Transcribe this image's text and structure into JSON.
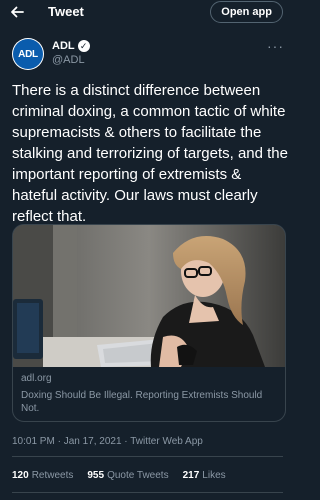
{
  "topbar": {
    "title": "Tweet",
    "open_app_label": "Open app"
  },
  "author": {
    "name": "ADL",
    "handle": "@ADL",
    "avatar_text": "ADL"
  },
  "tweet": {
    "text": "There is a distinct difference between criminal doxing, a common tactic of white supremacists & others to facilitate the stalking and terrorizing of targets, and the important reporting of extremists & hateful activity. Our laws must clearly reflect that."
  },
  "card": {
    "domain": "adl.org",
    "title": "Doxing Should Be Illegal. Reporting Extremists Should Not."
  },
  "meta": {
    "timestamp": "10:01 PM · Jan 17, 2021 · Twitter Web App"
  },
  "stats": {
    "retweets_count": "120",
    "retweets_label": "Retweets",
    "quote_count": "955",
    "quote_label": "Quote Tweets",
    "likes_count": "217",
    "likes_label": "Likes"
  },
  "icons": {
    "back": "back-arrow-icon",
    "verified": "verified-badge-icon",
    "more": "more-options-icon"
  },
  "colors": {
    "background": "#15202b",
    "border": "#38444d",
    "muted": "#8b98a5"
  }
}
